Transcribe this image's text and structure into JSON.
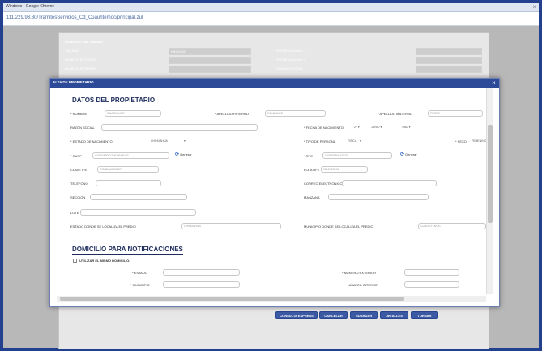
{
  "window": {
    "title": "Windows - Google Chrome"
  },
  "address": {
    "url": "111.229.93.80/TramitesServicios_Cd_Cuauhtemoc/principal.zul"
  },
  "background": {
    "section_title": "DOMICILIO DEL PREDIO",
    "labels": [
      "VIALIDAD",
      "NUMERO EXTERIOR",
      "NUMERO INTERIOR"
    ],
    "vialidad_value": "NINGUNO",
    "right_labels": [
      "ENTRE VIALIDAD 1",
      "ENTRE VIALIDAD 2",
      "CÓDIGO POSTAL"
    ]
  },
  "modal": {
    "title": "ALTA DE PROPIETARIO",
    "owner_section": "DATOS DEL PROPIETARIO",
    "fields": {
      "nombre": {
        "label": "* NOMBRE",
        "value": "GUADALUPE"
      },
      "apellido_paterno": {
        "label": "* APELLIDO PATERNO",
        "value": "GONZALEZ"
      },
      "apellido_materno": {
        "label": "* APELLIDO MATERNO",
        "value": "PEREZ"
      },
      "razon_social": {
        "label": "RAZÓN SOCIAL",
        "value": ""
      },
      "fecha_nacimiento": {
        "label": "* FECHA DE NACIMIENTO",
        "day": "27",
        "month": "JUNIO",
        "year": "1983"
      },
      "estado_nacimiento": {
        "label": "* ESTADO DE NACIMIENTO",
        "value": "CHIHUAHUA"
      },
      "tipo_persona": {
        "label": "* TIPO DE PERSONA",
        "value": "FISICA"
      },
      "sexo": {
        "label": "* SEXO",
        "value": "FEMENINO"
      },
      "curp": {
        "label": "* CURP",
        "value": "GOPG830627MCHNRD03",
        "generate": "Generar"
      },
      "rfc": {
        "label": "* RFC",
        "value": "GOPG830627IG8",
        "generate": "Generar"
      },
      "clave_ife": {
        "label": "CLAVE IFE",
        "value": "GONZAM830627"
      },
      "folio_ife": {
        "label": "FOLIO IFE",
        "value": "1212423594"
      },
      "telefono": {
        "label": "TELÉFONO",
        "value": ""
      },
      "correo": {
        "label": "CORREO ELECTRÓNICO",
        "value": ""
      },
      "seccion": {
        "label": "SECCIÓN",
        "value": ""
      },
      "manzana": {
        "label": "MANZANA",
        "value": ""
      },
      "lote": {
        "label": "LOTE",
        "value": ""
      },
      "estado_predio": {
        "label": "ESTADO DONDE SE LOCALIZA EL PREDIO",
        "value": "CHIHUAHUA"
      },
      "municipio_predio": {
        "label": "MUNICIPIO DONDE SE LOCALIZA EL PREDIO",
        "value": "CUAUHTEMOC"
      }
    },
    "notif_section": "DOMICILIO PARA NOTIFICACIONES",
    "same_address": "UTILIZAR EL MISMO DOMICILIO.",
    "notif": {
      "estado": "* ESTADO",
      "municipio": "* MUNICIPIO",
      "num_ext": "* NÚMERO EXTERIOR",
      "num_int": "NÚMERO INTERIOR"
    }
  },
  "buttons": {
    "consulta": "CONSULTA EXPRESS",
    "cancelar": "CANCELAR",
    "guardar": "GUARDAR",
    "detalles": "DETALLES",
    "turnar": "TURNAR"
  },
  "colors": {
    "modal_header": "#2c4a97",
    "page_bg": "#22408e",
    "section_title": "#1c2c5c"
  }
}
